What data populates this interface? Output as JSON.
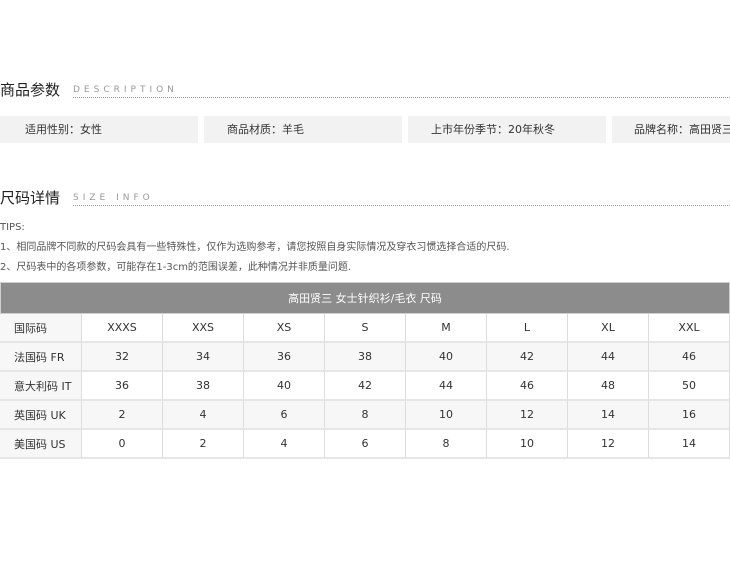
{
  "params_section": {
    "title": "商品参数",
    "subtitle": "DESCRIPTION"
  },
  "attributes": [
    "适用性别：女性",
    "商品材质：羊毛",
    "上市年份季节：20年秋冬",
    "品牌名称：高田贤三"
  ],
  "size_section": {
    "title": "尺码详情",
    "subtitle": "SIZE INFO"
  },
  "tips": {
    "heading": "TIPS:",
    "line1": "1、相同品牌不同款的尺码会具有一些特殊性，仅作为选购参考，请您按照自身实际情况及穿衣习惯选择合适的尺码.",
    "line2": "2、尺码表中的各项参数，可能存在1-3cm的范围误差，此种情况并非质量问题."
  },
  "size_table": {
    "caption": "高田贤三   女士针织衫/毛衣   尺码",
    "rows": [
      [
        "国际码",
        "XXXS",
        "XXS",
        "XS",
        "S",
        "M",
        "L",
        "XL",
        "XXL"
      ],
      [
        "法国码 FR",
        "32",
        "34",
        "36",
        "38",
        "40",
        "42",
        "44",
        "46"
      ],
      [
        "意大利码 IT",
        "36",
        "38",
        "40",
        "42",
        "44",
        "46",
        "48",
        "50"
      ],
      [
        "英国码 UK",
        "2",
        "4",
        "6",
        "8",
        "10",
        "12",
        "14",
        "16"
      ],
      [
        "美国码 US",
        "0",
        "2",
        "4",
        "6",
        "8",
        "10",
        "12",
        "14"
      ]
    ]
  }
}
